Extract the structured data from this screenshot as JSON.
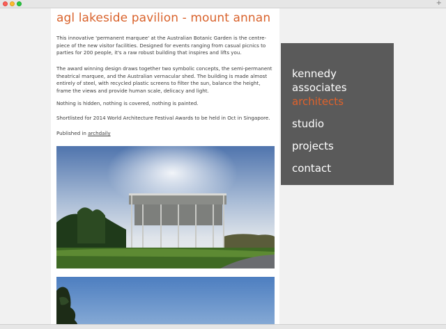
{
  "window": {
    "new_tab_icon": "plus-icon"
  },
  "article": {
    "title": "agl lakeside pavilion - mount annan",
    "paragraphs": [
      "This innovative 'permanent marquee' at the Australian Botanic Garden is the centre-piece of the new visitor facilities. Designed for events ranging from casual picnics to parties for 200 people, it's a raw robust building that inspires and lifts you.",
      "The award winning design draws together two symbolic concepts, the semi-permanent theatrical marquee, and the Australian vernacular shed. The building is made almost entirely of steel, with recycled plastic screens to filter the sun, balance the height, frame the views and provide human scale, delicacy and light.",
      "Nothing is hidden, nothing is covered, nothing is painted.",
      "Shortlisted for 2014 World Architecture Festival Awards to be held in Oct in Singapore."
    ],
    "published_prefix": "Published in",
    "published_link": "archdaily"
  },
  "sidebar": {
    "brand_line1": "kennedy",
    "brand_line2": "associates",
    "brand_line3": "architects",
    "nav": [
      "studio",
      "projects",
      "contact"
    ]
  },
  "colors": {
    "accent": "#e0622b",
    "panel": "#5a5a5a",
    "page_bg": "#f1f1f1"
  }
}
